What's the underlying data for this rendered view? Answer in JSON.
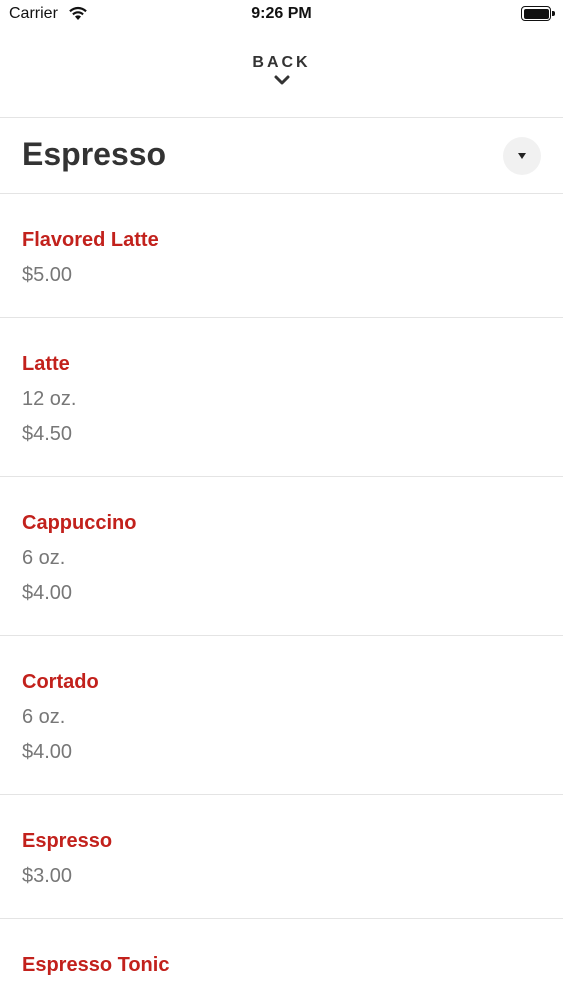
{
  "status_bar": {
    "carrier": "Carrier",
    "time": "9:26 PM"
  },
  "nav": {
    "back_label": "BACK"
  },
  "category": {
    "title": "Espresso"
  },
  "items": [
    {
      "name": "Flavored Latte",
      "details": [
        "$5.00"
      ]
    },
    {
      "name": "Latte",
      "details": [
        "12 oz.",
        "$4.50"
      ]
    },
    {
      "name": "Cappuccino",
      "details": [
        "6 oz.",
        "$4.00"
      ]
    },
    {
      "name": "Cortado",
      "details": [
        "6 oz.",
        "$4.00"
      ]
    },
    {
      "name": "Espresso",
      "details": [
        "$3.00"
      ]
    },
    {
      "name": "Espresso Tonic",
      "details": []
    }
  ],
  "colors": {
    "item_name": "#c2211c",
    "detail_text": "#777777",
    "title_text": "#333333",
    "divider": "#e4e4e4"
  },
  "icons": {
    "wifi": "wifi-icon",
    "battery": "battery-icon",
    "chevron": "chevron-down-icon",
    "dropdown": "dropdown-triangle-icon"
  }
}
